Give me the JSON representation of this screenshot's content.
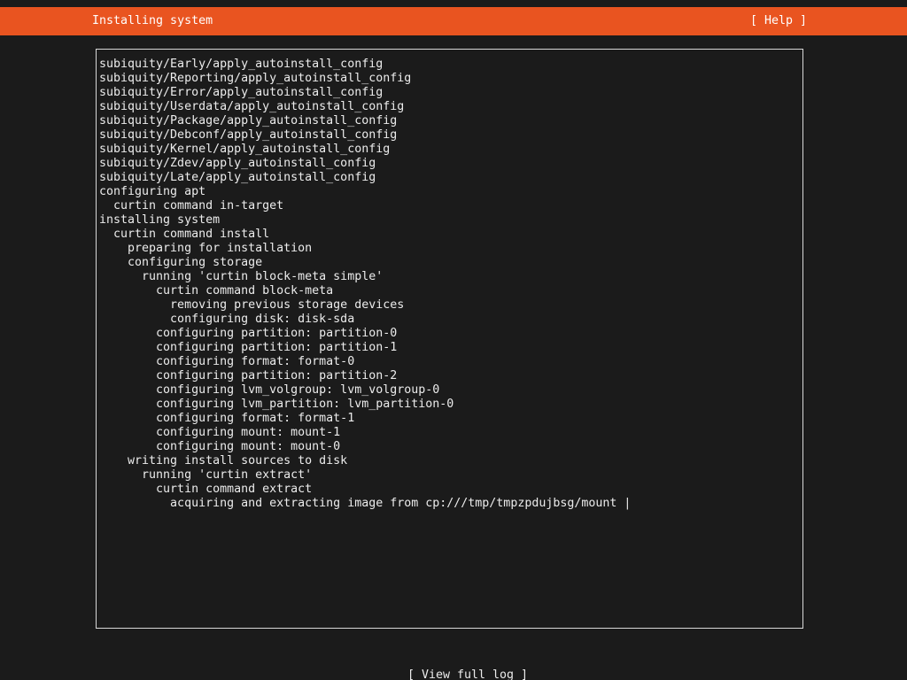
{
  "header": {
    "title": "Installing system",
    "help_label": "[ Help ]"
  },
  "log": {
    "lines": [
      "subiquity/Early/apply_autoinstall_config",
      "subiquity/Reporting/apply_autoinstall_config",
      "subiquity/Error/apply_autoinstall_config",
      "subiquity/Userdata/apply_autoinstall_config",
      "subiquity/Package/apply_autoinstall_config",
      "subiquity/Debconf/apply_autoinstall_config",
      "subiquity/Kernel/apply_autoinstall_config",
      "subiquity/Zdev/apply_autoinstall_config",
      "subiquity/Late/apply_autoinstall_config",
      "configuring apt",
      "  curtin command in-target",
      "installing system",
      "  curtin command install",
      "    preparing for installation",
      "    configuring storage",
      "      running 'curtin block-meta simple'",
      "        curtin command block-meta",
      "          removing previous storage devices",
      "          configuring disk: disk-sda",
      "        configuring partition: partition-0",
      "        configuring partition: partition-1",
      "        configuring format: format-0",
      "        configuring partition: partition-2",
      "        configuring lvm_volgroup: lvm_volgroup-0",
      "        configuring lvm_partition: lvm_partition-0",
      "        configuring format: format-1",
      "        configuring mount: mount-1",
      "        configuring mount: mount-0",
      "    writing install sources to disk",
      "      running 'curtin extract'",
      "        curtin command extract",
      "          acquiring and extracting image from cp:///tmp/tmpzpdujbsg/mount |"
    ]
  },
  "footer": {
    "view_log_label": "[ View full log ]"
  },
  "colors": {
    "header_bar": "#e95420",
    "background": "#1b1b1b",
    "text": "#ececec"
  }
}
